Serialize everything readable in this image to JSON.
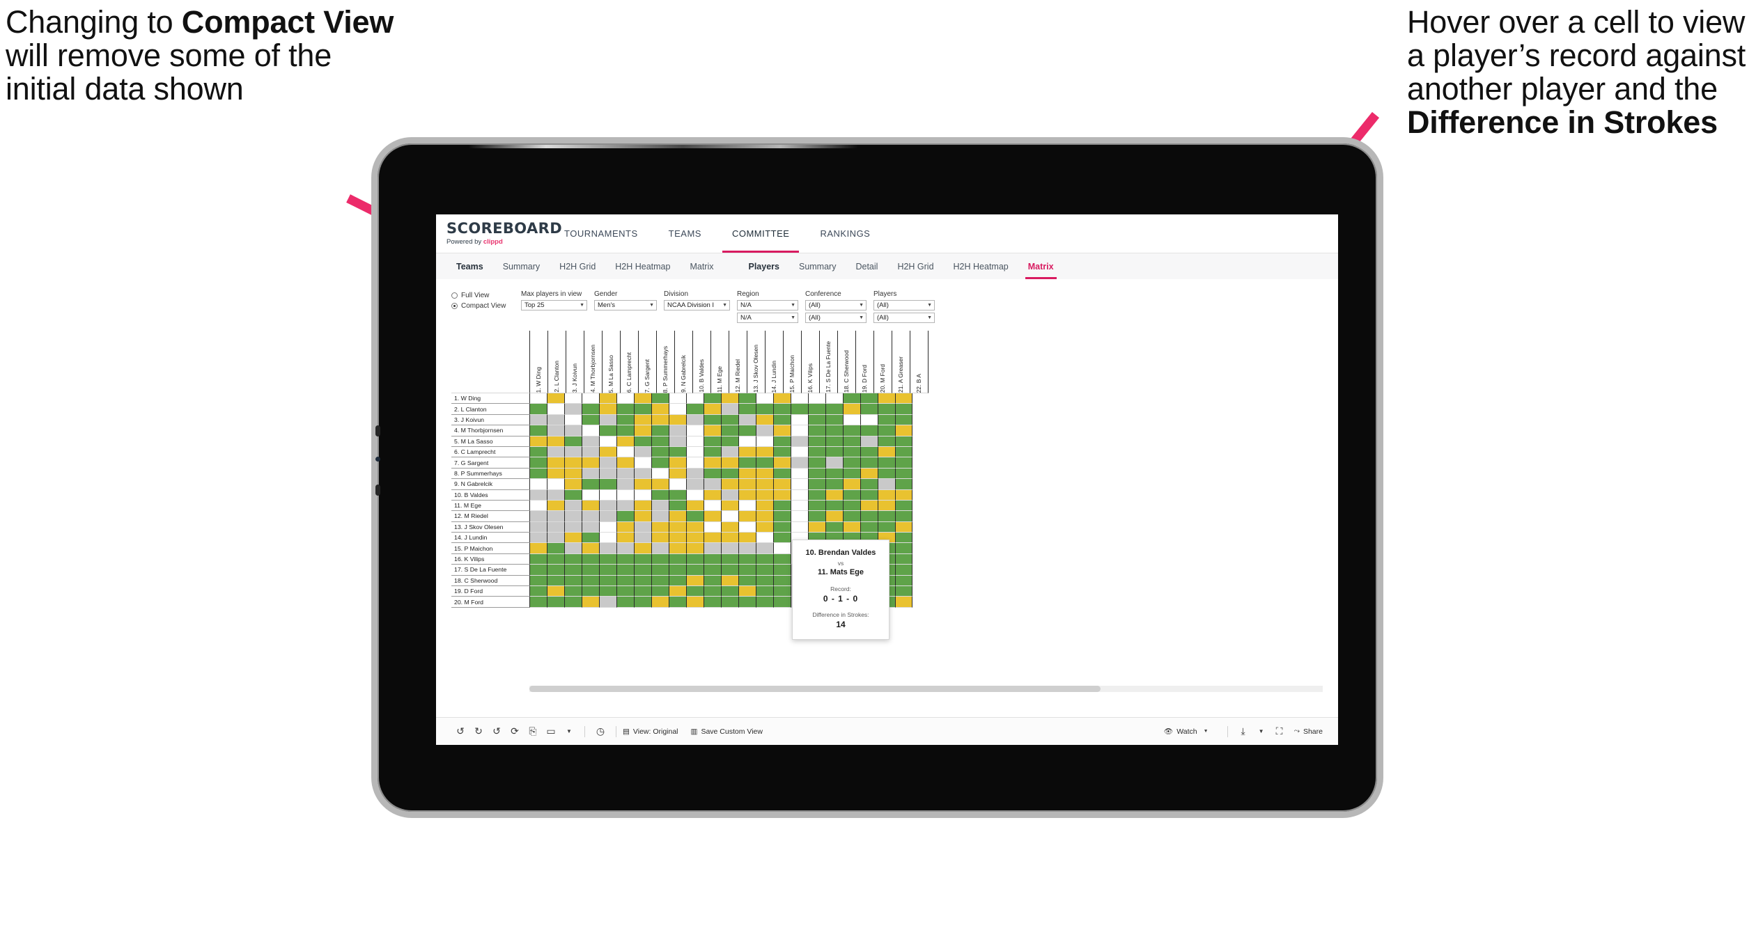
{
  "annotations": {
    "left": {
      "line1": "Changing to ",
      "bold": "Compact View",
      "line2": " will remove some of the initial data shown"
    },
    "right": {
      "line1": "Hover over a cell to view a player’s record against another player and the ",
      "bold": "Difference in Strokes"
    },
    "arrow_color": "#ec2b6a"
  },
  "app": {
    "logo": {
      "title": "SCOREBOARD",
      "powered_prefix": "Powered by ",
      "brand": "clippd"
    },
    "top_nav": [
      {
        "label": "TOURNAMENTS",
        "active": false
      },
      {
        "label": "TEAMS",
        "active": false
      },
      {
        "label": "COMMITTEE",
        "active": true
      },
      {
        "label": "RANKINGS",
        "active": false
      }
    ],
    "sub_tabs_group1": [
      {
        "label": "Teams",
        "active": false,
        "bold": true
      },
      {
        "label": "Summary",
        "active": false
      },
      {
        "label": "H2H Grid",
        "active": false
      },
      {
        "label": "H2H Heatmap",
        "active": false
      },
      {
        "label": "Matrix",
        "active": false
      }
    ],
    "sub_tabs_group2": [
      {
        "label": "Players",
        "active": false,
        "bold": true
      },
      {
        "label": "Summary",
        "active": false
      },
      {
        "label": "Detail",
        "active": false
      },
      {
        "label": "H2H Grid",
        "active": false
      },
      {
        "label": "H2H Heatmap",
        "active": false
      },
      {
        "label": "Matrix",
        "active": true
      }
    ]
  },
  "filters": {
    "view_mode": {
      "full_label": "Full View",
      "compact_label": "Compact View",
      "selected": "Compact View"
    },
    "max_players": {
      "label": "Max players in view",
      "value": "Top 25"
    },
    "gender": {
      "label": "Gender",
      "value": "Men's"
    },
    "division": {
      "label": "Division",
      "value": "NCAA Division I"
    },
    "region": {
      "label": "Region",
      "value1": "N/A",
      "value2": "N/A"
    },
    "conference": {
      "label": "Conference",
      "value1": "(All)",
      "value2": "(All)"
    },
    "players": {
      "label": "Players",
      "value1": "(All)",
      "value2": "(All)"
    }
  },
  "matrix": {
    "row_labels": [
      "1. W Ding",
      "2. L Clanton",
      "3. J Koivun",
      "4. M Thorbjornsen",
      "5. M La Sasso",
      "6. C Lamprecht",
      "7. G Sargent",
      "8. P Summerhays",
      "9. N Gabrelcik",
      "10. B Valdes",
      "11. M Ege",
      "12. M Riedel",
      "13. J Skov Olesen",
      "14. J Lundin",
      "15. P Maichon",
      "16. K Vilips",
      "17. S De La Fuente",
      "18. C Sherwood",
      "19. D Ford",
      "20. M Ford"
    ],
    "col_labels": [
      "1. W Ding",
      "2. L Clanton",
      "3. J Koivun",
      "4. M Thorbjornsen",
      "5. M La Sasso",
      "6. C Lamprecht",
      "7. G Sargent",
      "8. P Summerhays",
      "9. N Gabrelcik",
      "10. B Valdes",
      "11. M Ege",
      "12. M Riedel",
      "13. J Skov Olesen",
      "14. J Lundin",
      "15. P Maichon",
      "16. K Vilips",
      "17. S De La Fuente",
      "18. C Sherwood",
      "19. D Ford",
      "20. M Ford",
      "21. A Greaser",
      "22. B A"
    ],
    "legend_colors": {
      "win": "#5fa349",
      "tie": "#e9c230",
      "loss": "#c9c9c9",
      "none": "#ffffff"
    },
    "cells": [
      [
        "d",
        "y",
        "w",
        "w",
        "y",
        "w",
        "y",
        "g",
        "w",
        "w",
        "g",
        "y",
        "g",
        "w",
        "y",
        "w",
        "w",
        "w",
        "g",
        "g",
        "y",
        "y"
      ],
      [
        "g",
        "d",
        "a",
        "g",
        "y",
        "g",
        "g",
        "y",
        "w",
        "g",
        "y",
        "a",
        "g",
        "g",
        "g",
        "g",
        "g",
        "g",
        "y",
        "g",
        "g",
        "g"
      ],
      [
        "a",
        "a",
        "d",
        "g",
        "a",
        "g",
        "y",
        "y",
        "y",
        "a",
        "g",
        "g",
        "a",
        "y",
        "g",
        "w",
        "g",
        "g",
        "w",
        "w",
        "g",
        "g"
      ],
      [
        "g",
        "a",
        "a",
        "d",
        "g",
        "g",
        "y",
        "g",
        "a",
        "w",
        "y",
        "g",
        "g",
        "a",
        "y",
        "w",
        "g",
        "g",
        "g",
        "g",
        "g",
        "y"
      ],
      [
        "y",
        "y",
        "g",
        "a",
        "d",
        "y",
        "g",
        "g",
        "a",
        "w",
        "g",
        "g",
        "w",
        "w",
        "g",
        "a",
        "g",
        "g",
        "g",
        "a",
        "g",
        "g"
      ],
      [
        "g",
        "a",
        "a",
        "a",
        "y",
        "d",
        "a",
        "g",
        "g",
        "w",
        "g",
        "a",
        "y",
        "y",
        "g",
        "w",
        "g",
        "g",
        "g",
        "g",
        "y",
        "g"
      ],
      [
        "g",
        "y",
        "y",
        "y",
        "a",
        "y",
        "d",
        "g",
        "y",
        "w",
        "y",
        "y",
        "g",
        "g",
        "y",
        "a",
        "g",
        "a",
        "g",
        "g",
        "g",
        "g"
      ],
      [
        "g",
        "y",
        "y",
        "a",
        "a",
        "a",
        "a",
        "d",
        "y",
        "a",
        "g",
        "g",
        "y",
        "y",
        "g",
        "w",
        "g",
        "g",
        "g",
        "y",
        "g",
        "g"
      ],
      [
        "w",
        "w",
        "y",
        "g",
        "g",
        "a",
        "y",
        "y",
        "d",
        "a",
        "a",
        "y",
        "y",
        "y",
        "y",
        "w",
        "g",
        "g",
        "y",
        "g",
        "a",
        "g"
      ],
      [
        "a",
        "a",
        "g",
        "w",
        "w",
        "w",
        "w",
        "g",
        "g",
        "d",
        "y",
        "a",
        "y",
        "y",
        "y",
        "w",
        "g",
        "y",
        "g",
        "g",
        "y",
        "y"
      ],
      [
        "w",
        "y",
        "a",
        "y",
        "a",
        "a",
        "y",
        "a",
        "g",
        "y",
        "d",
        "y",
        "w",
        "y",
        "g",
        "w",
        "g",
        "g",
        "g",
        "y",
        "y",
        "g"
      ],
      [
        "a",
        "a",
        "a",
        "a",
        "a",
        "g",
        "y",
        "a",
        "y",
        "g",
        "y",
        "d",
        "y",
        "y",
        "g",
        "w",
        "g",
        "y",
        "g",
        "g",
        "g",
        "g"
      ],
      [
        "a",
        "a",
        "a",
        "a",
        "w",
        "y",
        "a",
        "y",
        "y",
        "y",
        "w",
        "y",
        "d",
        "y",
        "g",
        "w",
        "y",
        "g",
        "y",
        "g",
        "g",
        "y"
      ],
      [
        "a",
        "a",
        "y",
        "g",
        "w",
        "y",
        "a",
        "y",
        "y",
        "y",
        "y",
        "y",
        "y",
        "d",
        "g",
        "w",
        "g",
        "g",
        "g",
        "g",
        "y",
        "g"
      ],
      [
        "y",
        "g",
        "a",
        "y",
        "a",
        "a",
        "y",
        "a",
        "y",
        "y",
        "a",
        "a",
        "a",
        "a",
        "d",
        "w",
        "g",
        "g",
        "g",
        "g",
        "g",
        "g"
      ],
      [
        "g",
        "g",
        "g",
        "g",
        "g",
        "g",
        "g",
        "g",
        "g",
        "g",
        "g",
        "g",
        "g",
        "g",
        "g",
        "d",
        "g",
        "g",
        "g",
        "g",
        "g",
        "g"
      ],
      [
        "g",
        "g",
        "g",
        "g",
        "g",
        "g",
        "g",
        "g",
        "g",
        "g",
        "g",
        "g",
        "g",
        "g",
        "g",
        "a",
        "d",
        "g",
        "g",
        "y",
        "g",
        "g"
      ],
      [
        "g",
        "g",
        "g",
        "g",
        "g",
        "g",
        "g",
        "g",
        "g",
        "y",
        "g",
        "y",
        "g",
        "g",
        "g",
        "a",
        "a",
        "d",
        "g",
        "g",
        "g",
        "g"
      ],
      [
        "g",
        "y",
        "g",
        "g",
        "g",
        "g",
        "g",
        "g",
        "y",
        "g",
        "g",
        "g",
        "y",
        "g",
        "g",
        "a",
        "y",
        "a",
        "d",
        "g",
        "g",
        "g"
      ],
      [
        "g",
        "g",
        "g",
        "y",
        "a",
        "g",
        "g",
        "y",
        "g",
        "y",
        "g",
        "g",
        "g",
        "g",
        "g",
        "a",
        "g",
        "a",
        "a",
        "d",
        "g",
        "y"
      ]
    ]
  },
  "tooltip": {
    "player1": "10. Brendan Valdes",
    "vs": "vs",
    "player2": "11. Mats Ege",
    "record_label": "Record:",
    "record_value": "0 - 1 - 0",
    "strokes_label": "Difference in Strokes:",
    "strokes_value": "14"
  },
  "toolbar": {
    "icons": [
      "undo-icon",
      "redo-icon",
      "revert-icon",
      "refresh-icon",
      "pause-icon",
      "filter-icon",
      "dropdown-caret-icon",
      "help-icon"
    ],
    "view_label": "View: Original",
    "save_view_label": "Save Custom View",
    "watch_label": "Watch",
    "download_label": "download-icon",
    "fullscreen_label": "fullscreen-icon",
    "share_label": "Share"
  }
}
